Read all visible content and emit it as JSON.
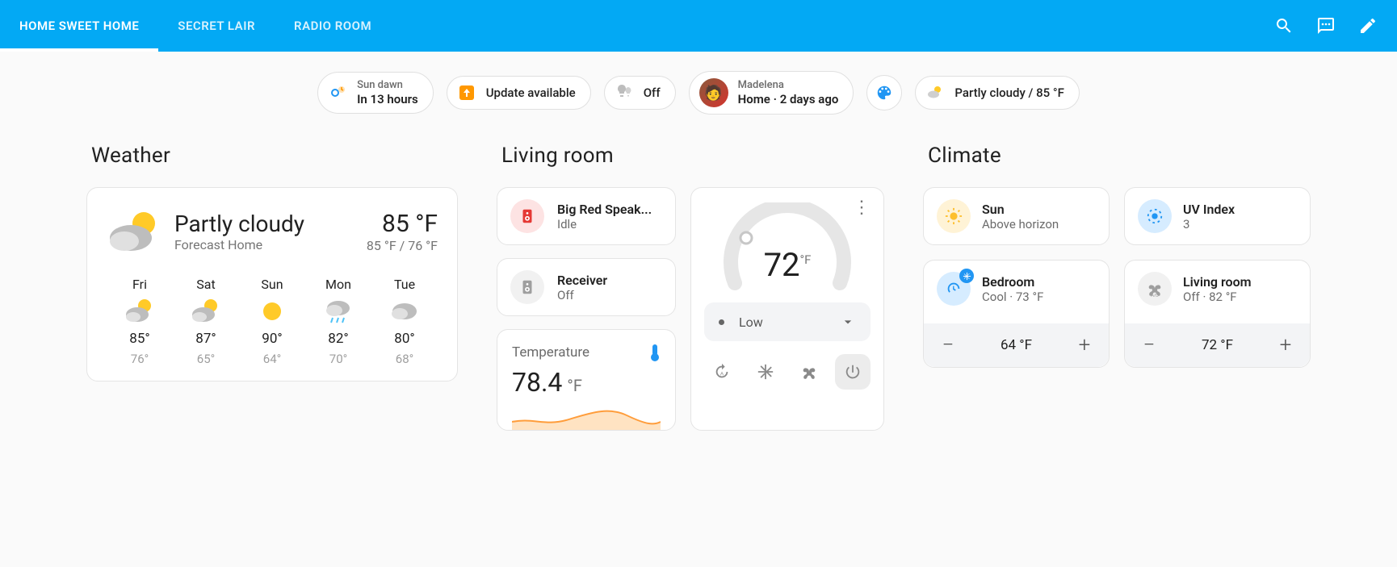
{
  "header": {
    "tabs": [
      "HOME SWEET HOME",
      "SECRET LAIR",
      "RADIO ROOM"
    ],
    "active_tab": 0
  },
  "chips": {
    "sun_dawn_label": "Sun dawn",
    "sun_dawn_value": "In 13 hours",
    "update": "Update available",
    "lights": "Off",
    "person_name": "Madelena",
    "person_state": "Home · 2 days ago",
    "weather": "Partly cloudy / 85 °F"
  },
  "sections": {
    "weather": "Weather",
    "living": "Living room",
    "climate": "Climate"
  },
  "weather": {
    "condition": "Partly cloudy",
    "location": "Forecast Home",
    "temp": "85 °F",
    "hilo": "85 °F / 76 °F",
    "days": [
      {
        "name": "Fri",
        "icon": "pcloud",
        "hi": "85°",
        "lo": "76°"
      },
      {
        "name": "Sat",
        "icon": "pcloud",
        "hi": "87°",
        "lo": "65°"
      },
      {
        "name": "Sun",
        "icon": "sun",
        "hi": "90°",
        "lo": "64°"
      },
      {
        "name": "Mon",
        "icon": "rain",
        "hi": "82°",
        "lo": "70°"
      },
      {
        "name": "Tue",
        "icon": "cloud",
        "hi": "80°",
        "lo": "68°"
      }
    ]
  },
  "living": {
    "speaker_name": "Big Red Speak...",
    "speaker_state": "Idle",
    "receiver_name": "Receiver",
    "receiver_state": "Off",
    "temp_label": "Temperature",
    "temp_value": "78.4",
    "temp_unit": "°F",
    "thermostat_value": "72",
    "thermostat_unit": "°F",
    "fan_mode": "Low"
  },
  "climate": {
    "sun_name": "Sun",
    "sun_state": "Above horizon",
    "uv_name": "UV Index",
    "uv_state": "3",
    "bedroom_name": "Bedroom",
    "bedroom_state": "Cool · 73 °F",
    "bedroom_set": "64 °F",
    "living_name": "Living room",
    "living_state": "Off · 82 °F",
    "living_set": "72 °F"
  }
}
